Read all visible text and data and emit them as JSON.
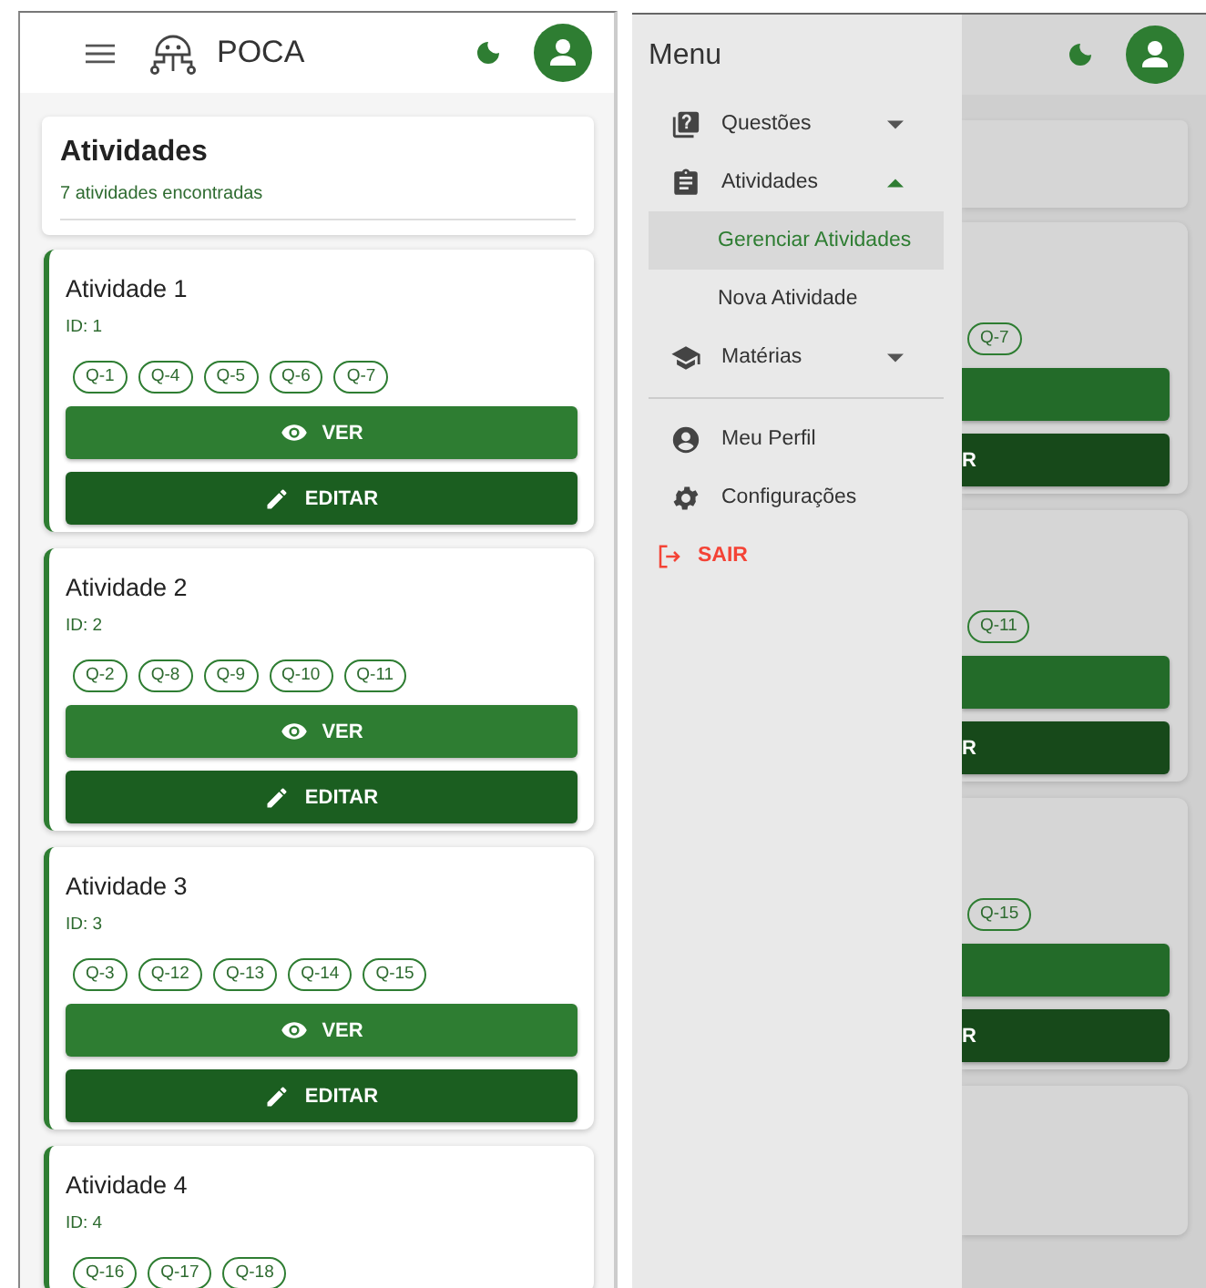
{
  "app_bar": {
    "title": "POCA"
  },
  "page": {
    "title": "Atividades",
    "subtitle": "7 atividades encontradas"
  },
  "activities": [
    {
      "title": "Atividade 1",
      "id": "ID: 1",
      "questions": [
        "Q-1",
        "Q-4",
        "Q-5",
        "Q-6",
        "Q-7"
      ],
      "actions": [
        {
          "kind": "view",
          "label": "VER"
        },
        {
          "kind": "edit",
          "label": "EDITAR"
        }
      ]
    },
    {
      "title": "Atividade 2",
      "id": "ID: 2",
      "questions": [
        "Q-2",
        "Q-8",
        "Q-9",
        "Q-10",
        "Q-11"
      ],
      "actions": [
        {
          "kind": "view",
          "label": "VER"
        },
        {
          "kind": "edit",
          "label": "EDITAR"
        }
      ]
    },
    {
      "title": "Atividade 3",
      "id": "ID: 3",
      "questions": [
        "Q-3",
        "Q-12",
        "Q-13",
        "Q-14",
        "Q-15"
      ],
      "actions": [
        {
          "kind": "view",
          "label": "VER"
        },
        {
          "kind": "edit",
          "label": "EDITAR"
        }
      ]
    },
    {
      "title": "Atividade 4",
      "id": "ID: 4",
      "questions": [
        "Q-16",
        "Q-17",
        "Q-18"
      ]
    }
  ],
  "drawer_screen": {
    "background": {
      "cards": [
        {
          "questions": [
            "Q-7"
          ],
          "actions": [
            {
              "kind": "view"
            },
            {
              "kind": "edit",
              "label": "R"
            }
          ]
        },
        {
          "questions": [
            "Q-11"
          ],
          "actions": [
            {
              "kind": "view"
            },
            {
              "kind": "edit",
              "label": "R"
            }
          ]
        },
        {
          "questions": [
            "Q-15"
          ],
          "actions": [
            {
              "kind": "view"
            },
            {
              "kind": "edit",
              "label": "R"
            }
          ]
        }
      ]
    },
    "menu": {
      "title": "Menu",
      "items": [
        {
          "kind": "group",
          "label": "Questões",
          "expanded": false
        },
        {
          "kind": "group",
          "label": "Atividades",
          "expanded": true,
          "children": [
            {
              "label": "Gerenciar Atividades",
              "selected": true
            },
            {
              "label": "Nova Atividade",
              "selected": false
            }
          ]
        },
        {
          "kind": "group",
          "label": "Matérias",
          "expanded": false
        },
        {
          "kind": "divider"
        },
        {
          "kind": "link",
          "label": "Meu Perfil"
        },
        {
          "kind": "link",
          "label": "Configurações"
        },
        {
          "kind": "logout",
          "label": "SAIR"
        }
      ]
    }
  }
}
